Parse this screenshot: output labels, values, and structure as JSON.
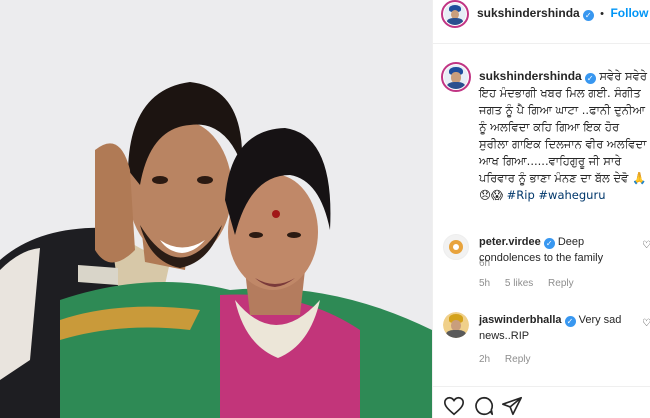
{
  "post": {
    "photo_alt": "",
    "author": {
      "username": "sukshindershinda",
      "follow_label": "Follow",
      "separator": "•"
    },
    "caption": {
      "username": "sukshindershinda",
      "text": "ਸਵੇਰੇ ਸਵੇਰੇ ਇਹ ਮੰਦਭਾਗੀ ਖਬਰ ਮਿਲ ਗਈ. ਸੰਗੀਤ ਜਗਤ ਨੂੰ ਪੈ ਗਿਆ ਘਾਟਾ ..ਫਾਨੀ ਦੁਨੀਆ ਨੂੰ ਅਲਵਿਦਾ ਕਹਿ ਗਿਆ ਇਕ ਹੋਰ ਸੁਰੀਲਾ ਗਾਇਕ ਦਿਲਜਾਨ ਵੀਰ ਅਲਵਿਦਾ ਆਖ ਗਿਆ......ਵਾਹਿਗੁਰੂ ਜੀ ਸਾਰੇ ਪਰਿਵਾਰ ਨੂੰ ਭਾਣਾ ਮੰਨਣ ਦਾ ਬੱਲ ਦੇਵੋ 🙏😞😱",
      "hashtag_rip": "#Rip",
      "hashtag_waheguru": "#waheguru",
      "time": "6h"
    },
    "comments": [
      {
        "username": "peter.virdee",
        "text": "Deep condolences to the family",
        "time": "5h",
        "likes": "5 likes",
        "reply": "Reply"
      },
      {
        "username": "jaswinderbhalla",
        "text": "Very sad news..RIP",
        "time": "2h",
        "likes": "",
        "reply": "Reply"
      }
    ]
  },
  "icons": [
    "heart-icon",
    "comment-icon",
    "share-icon",
    "verified-icon"
  ],
  "colors": {
    "accent": "#0095f6",
    "verified": "#3897f0",
    "muted": "#8e8e8e"
  }
}
